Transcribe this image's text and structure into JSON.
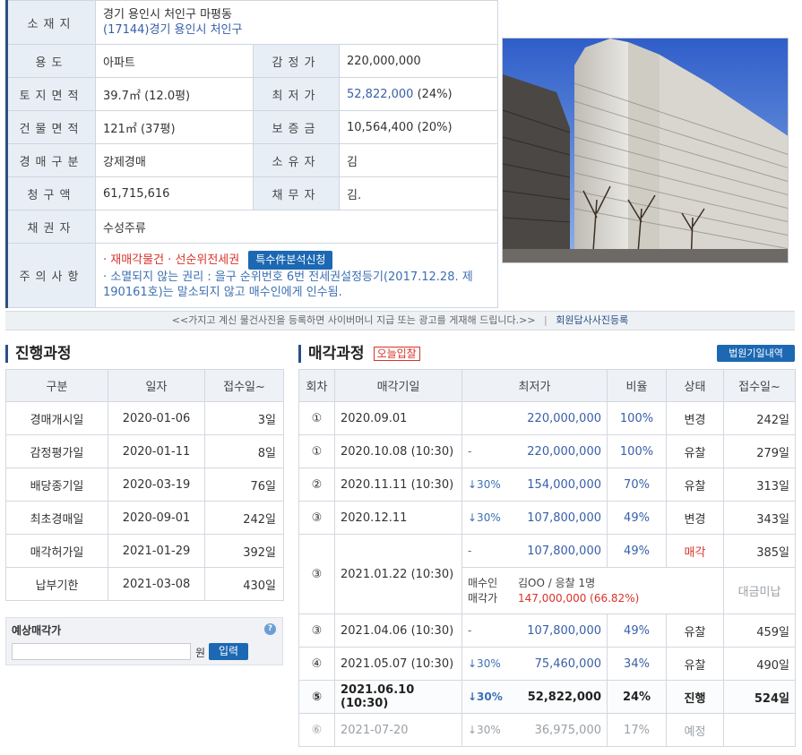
{
  "info": {
    "location_label": "소재지",
    "address_line1": "경기 용인시 처인구 마평동",
    "address_line2": "(17144)경기 용인시 처인구",
    "use_label": "용도",
    "use_value": "아파트",
    "appraisal_label": "감정가",
    "appraisal_value": "220,000,000",
    "land_label": "토지면적",
    "land_value": "39.7㎡ (12.0평)",
    "min_label": "최저가",
    "min_value": "52,822,000",
    "min_pct": "(24%)",
    "building_label": "건물면적",
    "building_value": "121㎡ (37평)",
    "deposit_label": "보증금",
    "deposit_value": "10,564,400 (20%)",
    "type_label": "경매구분",
    "type_value": "강제경매",
    "owner_label": "소유자",
    "owner_value": "김",
    "claim_label": "청구액",
    "claim_value": "61,715,616",
    "debtor_label": "채무자",
    "debtor_value": "김.",
    "creditor_label": "채권자",
    "creditor_value": "수성주류",
    "caution_label": "주의사항",
    "caution_line1": "· 재매각물건 · 선순위전세권",
    "special_button": "특수件분석신청",
    "caution_line2": "· 소멸되지 않는 권리 : 을구 순위번호 6번 전세권설정등기(2017.12.28. 제190161호)는 말소되지 않고 매수인에게 인수됨."
  },
  "notice": {
    "text": "<<가지고 계신 물건사진을 등록하면 사이버머니 지급 또는 광고를 게재해 드립니다.>>",
    "separator": "|",
    "link": "회원답사사진등록"
  },
  "progress": {
    "title": "진행과정",
    "headers": [
      "구분",
      "일자",
      "접수일~"
    ],
    "rows": [
      [
        "경매개시일",
        "2020-01-06",
        "3일"
      ],
      [
        "감정평가일",
        "2020-01-11",
        "8일"
      ],
      [
        "배당종기일",
        "2020-03-19",
        "76일"
      ],
      [
        "최초경매일",
        "2020-09-01",
        "242일"
      ],
      [
        "매각허가일",
        "2021-01-29",
        "392일"
      ],
      [
        "납부기한",
        "2021-03-08",
        "430일"
      ]
    ]
  },
  "estimate": {
    "title": "예상매각가",
    "help_icon": "?",
    "input_value": "",
    "unit": "원",
    "button": "입력"
  },
  "auction": {
    "title": "매각과정",
    "today_tag": "오늘입찰",
    "court_button": "법원기일내역",
    "headers": [
      "회차",
      "매각기일",
      "최저가",
      "비율",
      "상태",
      "접수일~"
    ],
    "rows": [
      {
        "round": "①",
        "date": "2020.09.01",
        "cut": "",
        "price": "220,000,000",
        "ratio": "100%",
        "status": "변경",
        "days": "242일"
      },
      {
        "round": "①",
        "date": "2020.10.08 (10:30)",
        "cut": "-",
        "price": "220,000,000",
        "ratio": "100%",
        "status": "유찰",
        "days": "279일"
      },
      {
        "round": "②",
        "date": "2020.11.11 (10:30)",
        "cut": "↓30%",
        "price": "154,000,000",
        "ratio": "70%",
        "status": "유찰",
        "days": "313일"
      },
      {
        "round": "③",
        "date": "2020.12.11",
        "cut": "↓30%",
        "price": "107,800,000",
        "ratio": "49%",
        "status": "변경",
        "days": "343일"
      }
    ],
    "sold": {
      "round": "③",
      "date": "2021.01.22 (10:30)",
      "cut": "-",
      "price": "107,800,000",
      "ratio": "49%",
      "status": "매각",
      "days": "385일",
      "buyer_label": "매수인",
      "buyer_value": "김OO  / 응찰 1명",
      "sale_label": "매각가",
      "sale_value": "147,000,000 (66.82%)",
      "note": "대금미납"
    },
    "rows2": [
      {
        "round": "③",
        "date": "2021.04.06 (10:30)",
        "cut": "-",
        "price": "107,800,000",
        "ratio": "49%",
        "status": "유찰",
        "days": "459일"
      },
      {
        "round": "④",
        "date": "2021.05.07 (10:30)",
        "cut": "↓30%",
        "price": "75,460,000",
        "ratio": "34%",
        "status": "유찰",
        "days": "490일"
      }
    ],
    "current": {
      "round": "⑤",
      "date": "2021.06.10 (10:30)",
      "cut": "↓30%",
      "price": "52,822,000",
      "ratio": "24%",
      "status": "진행",
      "days": "524일"
    },
    "future": {
      "round": "⑥",
      "date": "2021-07-20",
      "cut": "↓30%",
      "price": "36,975,000",
      "ratio": "17%",
      "status": "예정",
      "days": ""
    }
  }
}
